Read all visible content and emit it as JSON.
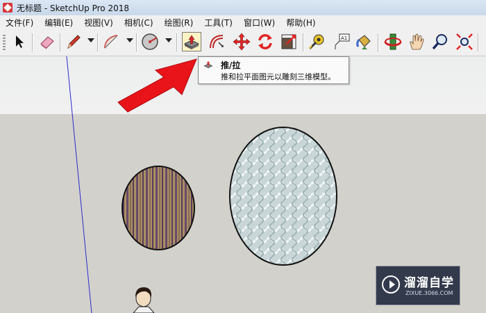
{
  "window": {
    "title": "无标题 - SketchUp Pro 2018"
  },
  "menu": [
    "文件(F)",
    "编辑(E)",
    "视图(V)",
    "相机(C)",
    "绘图(R)",
    "工具(T)",
    "窗口(W)",
    "帮助(H)"
  ],
  "toolbar": {
    "tools": [
      "select",
      "eraser",
      "pencil-line",
      "arc",
      "circle",
      "push-pull",
      "offset",
      "move",
      "rotate",
      "scale",
      "tape-measure",
      "text",
      "paint-bucket",
      "orbit",
      "pan",
      "zoom",
      "zoom-extents"
    ],
    "active_tool": "push-pull"
  },
  "tooltip": {
    "title": "推/拉",
    "description": "推和拉平面图元以雕刻三维模型。"
  },
  "watermark": {
    "name": "溜溜自学",
    "url": "ZIXUE.3066.COM"
  },
  "colors": {
    "arrow": "#e8141a",
    "sky": "#eeeeee",
    "ground": "#d2d1cb",
    "titlebar": "#c8d8ea"
  }
}
